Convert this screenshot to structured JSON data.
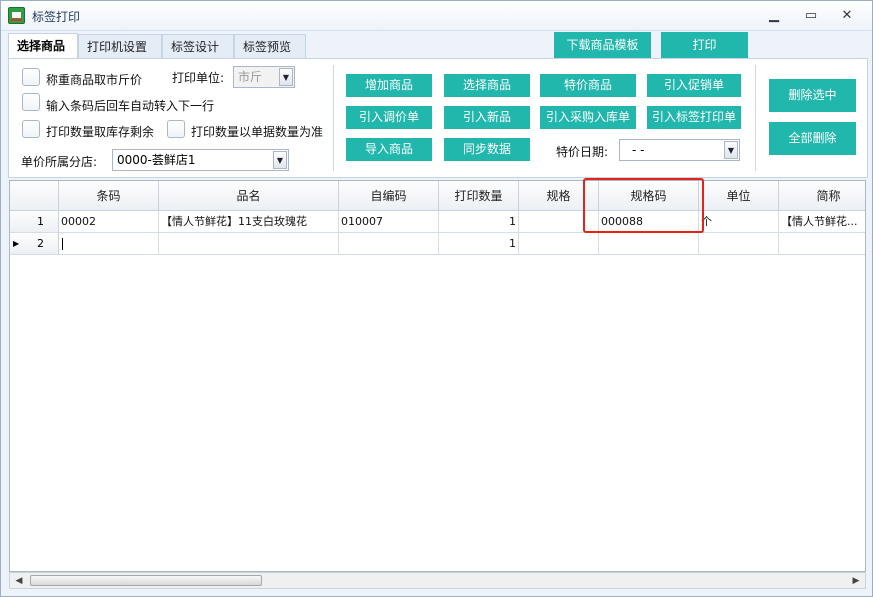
{
  "window": {
    "title": "标签打印",
    "minimize": "▁",
    "maximize": "▭",
    "close": "✕"
  },
  "tabs": [
    {
      "label": "选择商品",
      "active": true
    },
    {
      "label": "打印机设置",
      "active": false
    },
    {
      "label": "标签设计",
      "active": false
    },
    {
      "label": "标签预览",
      "active": false
    }
  ],
  "top_buttons": {
    "download_template": "下载商品模板",
    "print": "打印"
  },
  "options": {
    "weigh_market_price": "称重商品取市斤价",
    "auto_next_row": "输入条码后回车自动转入下一行",
    "qty_from_stock": "打印数量取库存剩余",
    "qty_from_doc": "打印数量以单据数量为准",
    "print_unit_label": "打印单位:",
    "print_unit_value": "市斤",
    "branch_label": "单价所属分店:",
    "branch_value": "0000-荟鲜店1",
    "special_date_label": "特价日期:",
    "special_date_value": "-    -"
  },
  "actions": {
    "add_product": "增加商品",
    "select_product": "选择商品",
    "special_product": "特价商品",
    "import_promo": "引入促销单",
    "import_price_adjust": "引入调价单",
    "import_new": "引入新品",
    "import_purchase": "引入采购入库单",
    "import_label_print": "引入标签打印单",
    "import_products": "导入商品",
    "sync_data": "同步数据",
    "delete_selected": "删除选中",
    "delete_all": "全部删除"
  },
  "table": {
    "columns": [
      "条码",
      "品名",
      "自编码",
      "打印数量",
      "规格",
      "规格码",
      "单位",
      "简称"
    ],
    "rows": [
      {
        "num": "1",
        "barcode": "00002",
        "name": "【情人节鲜花】11支白玫瑰花",
        "code": "010007",
        "qty": "1",
        "spec": "",
        "spec_code": "000088",
        "unit": "个",
        "short": "【情人节鲜花..."
      },
      {
        "num": "2",
        "barcode": "",
        "name": "",
        "code": "",
        "qty": "1",
        "spec": "",
        "spec_code": "",
        "unit": "",
        "short": ""
      }
    ]
  },
  "colors": {
    "accent": "#21b7ac",
    "highlight_border": "#e5231b"
  }
}
